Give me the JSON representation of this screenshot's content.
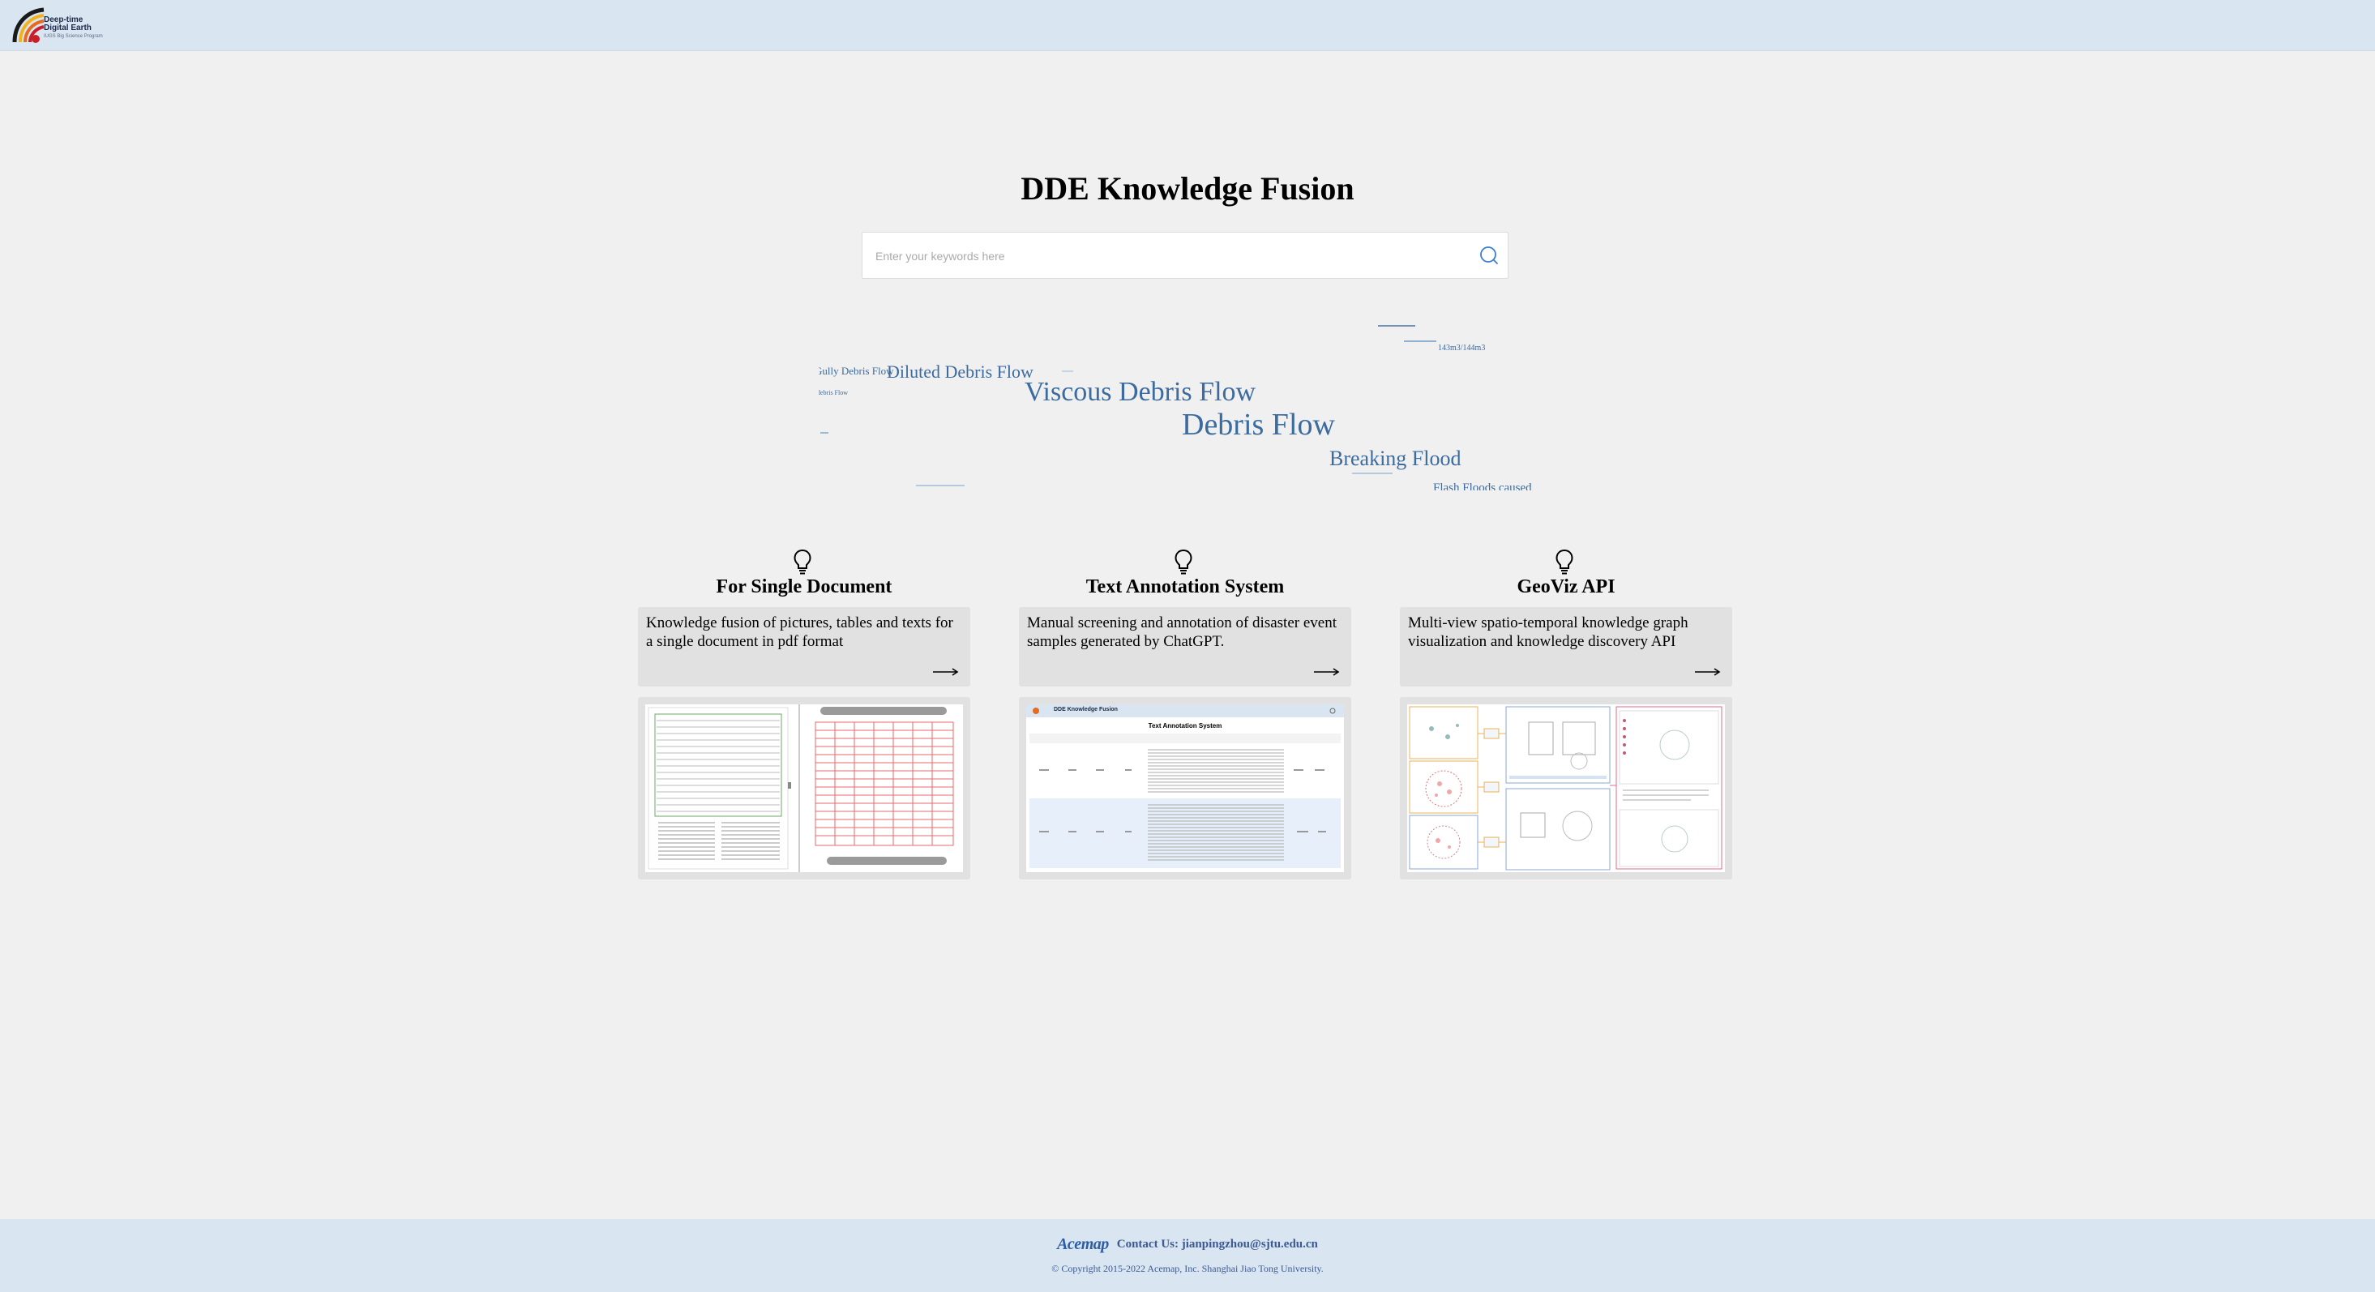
{
  "header": {
    "logo_line1": "Deep-time",
    "logo_line2": "Digital Earth",
    "logo_line3": "IUGS Big Science Program"
  },
  "page_title": "DDE Knowledge Fusion",
  "search": {
    "placeholder": "Enter your keywords here",
    "value": ""
  },
  "word_cloud": [
    "Gully Debris Flow",
    "Diluted Debris Flow",
    "Viscous Debris Flow",
    "Debris Flow",
    "Breaking Flood",
    "Flash Floods caused",
    "143m3/144m3",
    "debris Flow"
  ],
  "features": [
    {
      "title": "For Single Document",
      "description": "Knowledge fusion of pictures, tables and texts for a single document in pdf format"
    },
    {
      "title": "Text Annotation System",
      "description": "Manual screening and annotation of disaster event samples generated by ChatGPT."
    },
    {
      "title": "GeoViz API",
      "description": "Multi-view spatio-temporal knowledge graph visualization and knowledge discovery API"
    }
  ],
  "previews": {
    "annotation_app_title": "DDE Knowledge Fusion",
    "annotation_heading": "Text Annotation System"
  },
  "footer": {
    "acemap": "Acemap",
    "contact": "Contact Us: jianpingzhou@sjtu.edu.cn",
    "copyright": "© Copyright 2015-2022 Acemap, Inc. Shanghai Jiao Tong University."
  },
  "colors": {
    "header_bg": "#dae5f2",
    "page_bg": "#f1f0f1",
    "card_bg": "#e2e1e2",
    "cloud_text": "#3b6b9f",
    "footer_text": "#3b5a93"
  }
}
